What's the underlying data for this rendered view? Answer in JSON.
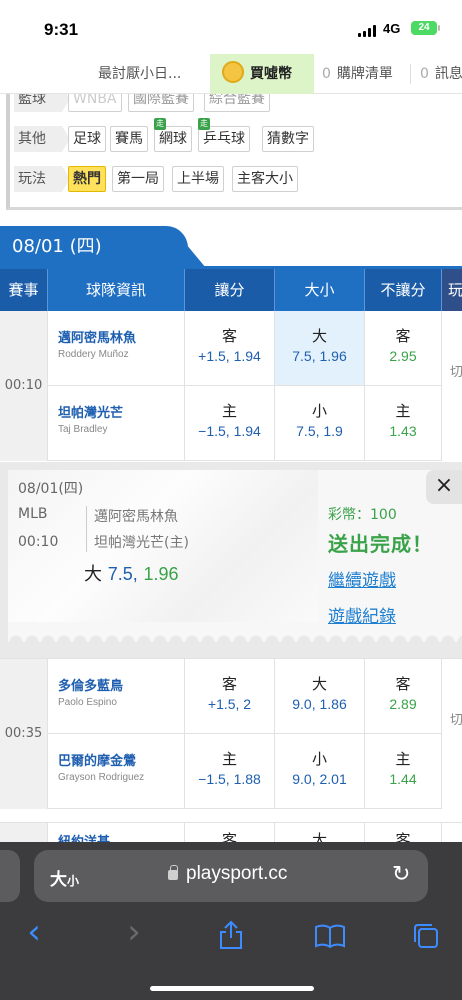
{
  "status": {
    "time": "9:31",
    "network": "4G",
    "battery": "24"
  },
  "topnav": {
    "tabs": [
      {
        "label": "最討厭小日..."
      },
      {
        "label": "買噓幣",
        "active": true
      },
      {
        "count": "0",
        "label": "購牌清單"
      },
      {
        "count": "0",
        "label": "訊息"
      }
    ]
  },
  "filters": {
    "row0": {
      "label": "籃球",
      "chips": [
        "WNBA",
        "國際籃賽",
        "綜合籃賽"
      ]
    },
    "row1": {
      "label": "其他",
      "chips": [
        "足球",
        "賽馬",
        "網球",
        "乒乓球",
        "猜數字"
      ],
      "badge": "走"
    },
    "row2": {
      "label": "玩法",
      "chips": [
        "熱門",
        "第一局",
        "上半場",
        "主客大小"
      ],
      "selected": "熱門"
    }
  },
  "date_banner": "08/01 (四)",
  "table_header": [
    "賽事",
    "球隊資訊",
    "讓分",
    "大小",
    "不讓分",
    "玩"
  ],
  "games": [
    {
      "time": "00:10",
      "rows": [
        {
          "team": "邁阿密馬林魚",
          "pitcher": "Roddery Muñoz",
          "spread_k": "客",
          "spread_v": "+1.5, 1.94",
          "total_k": "大",
          "total_v": "7.5, 1.96",
          "ml_k": "客",
          "ml_v": "2.95"
        },
        {
          "team": "坦帕灣光芒",
          "pitcher": "Taj Bradley",
          "spread_k": "主",
          "spread_v": "−1.5, 1.94",
          "total_k": "小",
          "total_v": "7.5, 1.9",
          "ml_k": "主",
          "ml_v": "1.43"
        }
      ],
      "switch": "切"
    },
    {
      "time": "00:35",
      "rows": [
        {
          "team": "多倫多藍鳥",
          "pitcher": "Paolo Espino",
          "spread_k": "客",
          "spread_v": "+1.5, 2",
          "total_k": "大",
          "total_v": "9.0, 1.86",
          "ml_k": "客",
          "ml_v": "2.89"
        },
        {
          "team": "巴爾的摩金鶯",
          "pitcher": "Grayson Rodriguez",
          "spread_k": "主",
          "spread_v": "−1.5, 1.88",
          "total_k": "小",
          "total_v": "9.0, 2.01",
          "ml_k": "主",
          "ml_v": "1.44"
        }
      ],
      "switch": "切"
    },
    {
      "rows": [
        {
          "team": "紐約洋基",
          "spread_k": "客",
          "total_k": "大",
          "ml_k": "客"
        }
      ]
    }
  ],
  "popup": {
    "date": "08/01(四)",
    "league": "MLB",
    "time": "00:10",
    "team1": "邁阿密馬林魚",
    "team2": "坦帕灣光芒(主)",
    "pick_label": "大",
    "pick_value": "7.5,",
    "pick_odds": "1.96",
    "coins": "彩幣：100",
    "done": "送出完成！",
    "continue": "繼續遊戲",
    "history": "遊戲紀錄",
    "close": "×"
  },
  "browser": {
    "aa": "大",
    "aa_small": "小",
    "url": "playsport.cc",
    "reload": "↻",
    "back": "‹",
    "forward": "›"
  }
}
